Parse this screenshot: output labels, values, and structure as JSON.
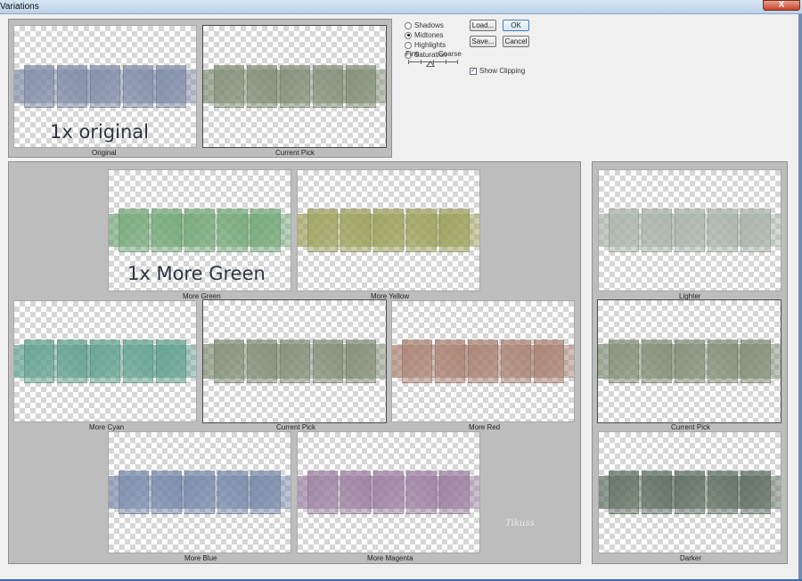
{
  "window": {
    "title": "Variations",
    "close_symbol": "X"
  },
  "options": {
    "tones": [
      {
        "label": "Shadows",
        "selected": false
      },
      {
        "label": "Midtones",
        "selected": true
      },
      {
        "label": "Highlights",
        "selected": false
      },
      {
        "label": "Saturation",
        "selected": false
      }
    ],
    "slider": {
      "fine_label": "Fine",
      "coarse_label": "Coarse",
      "value": 0.5
    },
    "show_clipping": {
      "label": "Show Clipping",
      "checked": true
    }
  },
  "buttons": {
    "load": "Load...",
    "save": "Save...",
    "ok": "OK",
    "cancel": "Cancel"
  },
  "top": {
    "original_caption": "Original",
    "current_pick_caption": "Current Pick",
    "original_overlay": "1x original"
  },
  "color_grid": {
    "more_green": "More Green",
    "more_yellow": "More Yellow",
    "more_cyan": "More Cyan",
    "current_pick": "Current Pick",
    "more_red": "More Red",
    "more_blue": "More Blue",
    "more_magenta": "More Magenta",
    "green_overlay": "1x More Green"
  },
  "brightness": {
    "lighter": "Lighter",
    "current_pick": "Current Pick",
    "darker": "Darker"
  },
  "tints": {
    "original": "#7e8aa6",
    "current": "#7f8d74",
    "green": "#72a776",
    "yellow": "#9ba05a",
    "cyan": "#5fa08c",
    "red": "#a88070",
    "blue": "#7687a8",
    "magenta": "#9a7f9f",
    "lighter": "#a7b3a9",
    "darker": "#5c6c5d"
  },
  "watermark_text": "Tikuss"
}
